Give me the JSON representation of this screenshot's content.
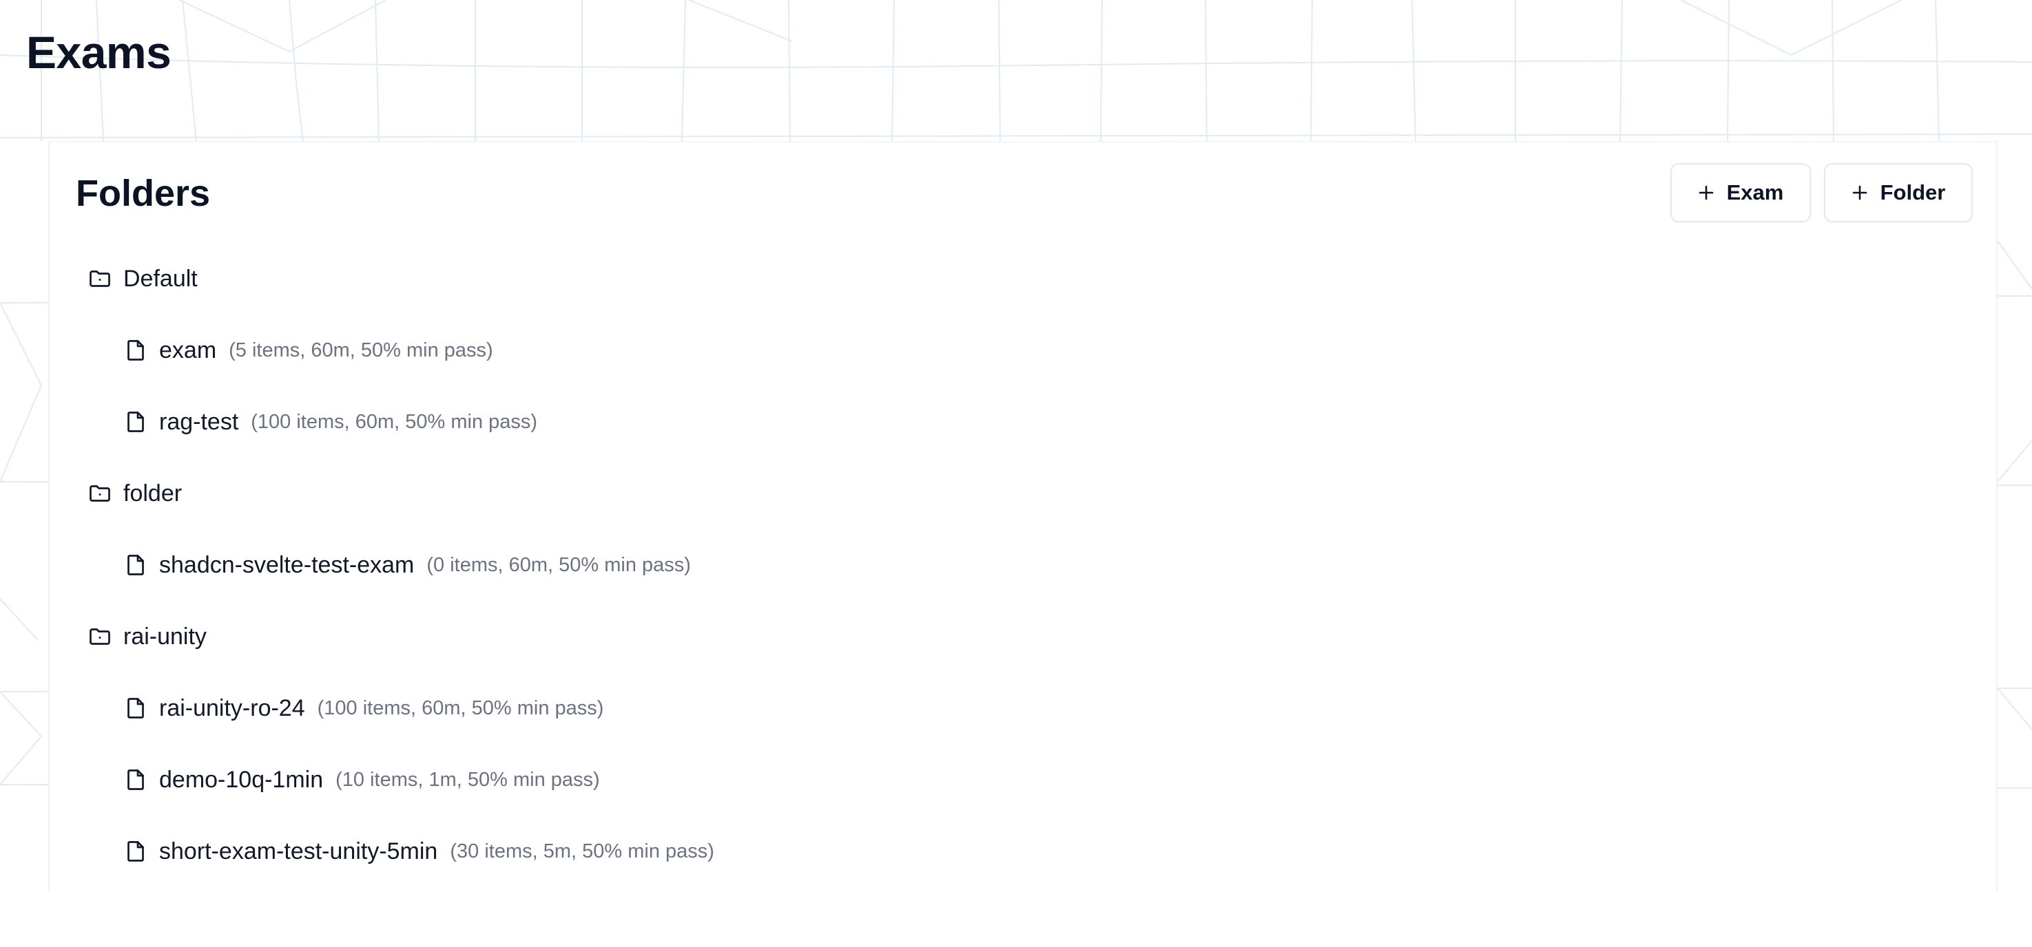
{
  "page": {
    "title": "Exams"
  },
  "card": {
    "title": "Folders"
  },
  "actions": {
    "add_exam_label": "Exam",
    "add_folder_label": "Folder"
  },
  "folders": [
    {
      "name": "Default",
      "icon": "folder-icon",
      "exams": [
        {
          "name": "exam",
          "meta": "(5 items, 60m, 50% min pass)",
          "icon": "file-icon"
        },
        {
          "name": "rag-test",
          "meta": "(100 items, 60m, 50% min pass)",
          "icon": "file-icon"
        }
      ]
    },
    {
      "name": "folder",
      "icon": "folder-icon",
      "exams": [
        {
          "name": "shadcn-svelte-test-exam",
          "meta": "(0 items, 60m, 50% min pass)",
          "icon": "file-icon"
        }
      ]
    },
    {
      "name": "rai-unity",
      "icon": "folder-icon",
      "exams": [
        {
          "name": "rai-unity-ro-24",
          "meta": "(100 items, 60m, 50% min pass)",
          "icon": "file-icon"
        },
        {
          "name": "demo-10q-1min",
          "meta": "(10 items, 1m, 50% min pass)",
          "icon": "file-icon"
        },
        {
          "name": "short-exam-test-unity-5min",
          "meta": "(30 items, 5m, 50% min pass)",
          "icon": "file-icon"
        }
      ]
    }
  ],
  "colors": {
    "text_primary": "#0b1324",
    "text_secondary": "#6b7280",
    "border": "#e5e8ee",
    "pattern": "#dbe7f3"
  }
}
